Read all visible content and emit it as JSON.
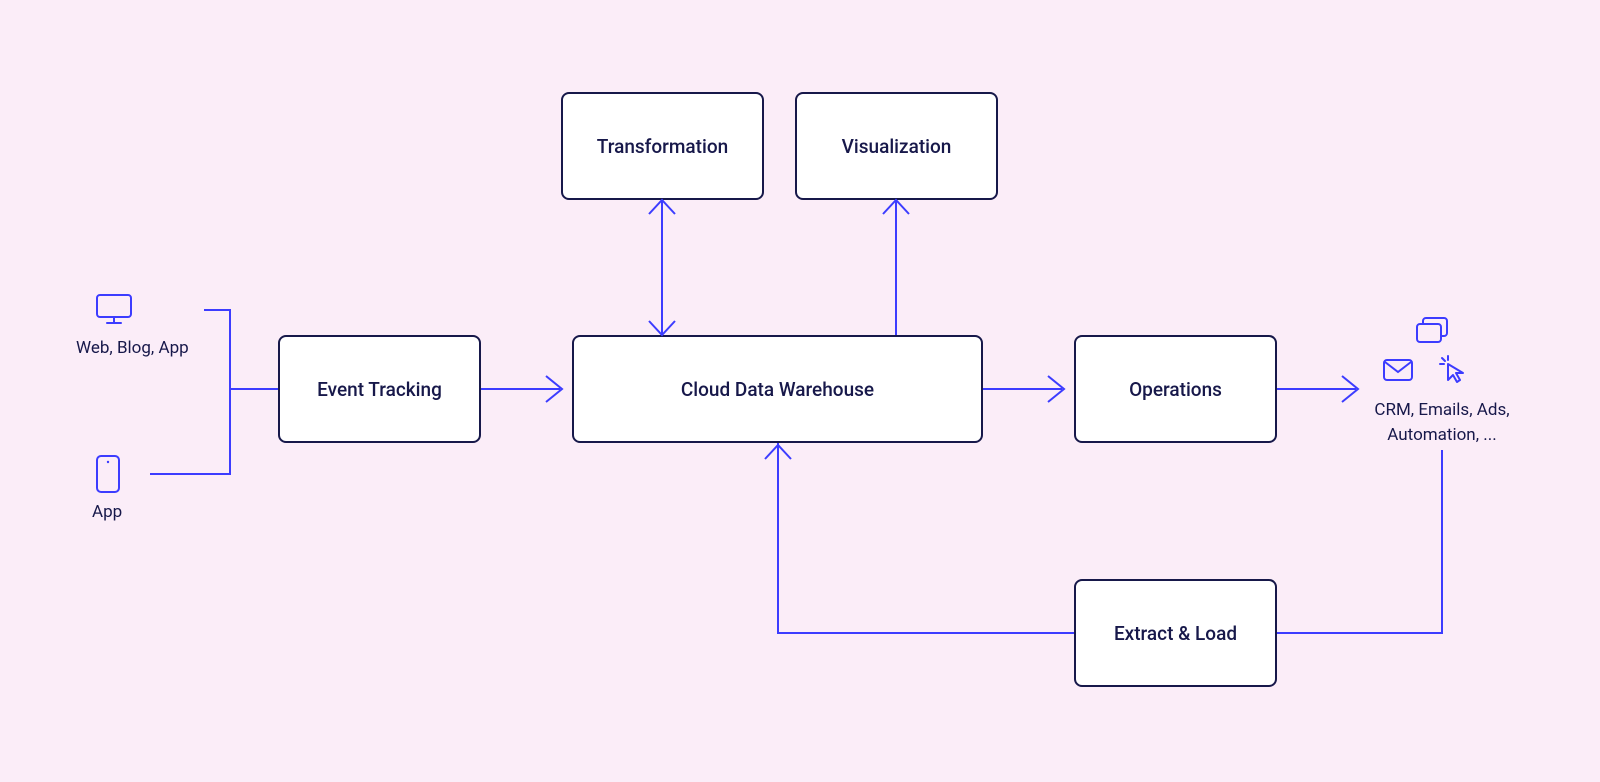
{
  "sources": {
    "web_label": "Web, Blog, App",
    "app_label": "App"
  },
  "nodes": {
    "event_tracking": "Event Tracking",
    "transformation": "Transformation",
    "visualization": "Visualization",
    "warehouse": "Cloud Data Warehouse",
    "operations": "Operations",
    "extract_load": "Extract & Load"
  },
  "destinations": {
    "label_line1": "CRM, Emails, Ads,",
    "label_line2": "Automation, ..."
  },
  "colors": {
    "background": "#fbedf8",
    "box_border": "#17184a",
    "box_fill": "#ffffff",
    "connector": "#3c3cff",
    "text": "#17184a"
  },
  "diagram_structure": {
    "description": "Data pipeline architecture diagram",
    "flows": [
      {
        "from": "Web, Blog, App",
        "to": "Event Tracking",
        "direction": "right"
      },
      {
        "from": "App",
        "to": "Event Tracking",
        "direction": "right"
      },
      {
        "from": "Event Tracking",
        "to": "Cloud Data Warehouse",
        "direction": "right"
      },
      {
        "from": "Cloud Data Warehouse",
        "to": "Transformation",
        "direction": "bidirectional"
      },
      {
        "from": "Cloud Data Warehouse",
        "to": "Visualization",
        "direction": "up"
      },
      {
        "from": "Cloud Data Warehouse",
        "to": "Operations",
        "direction": "right"
      },
      {
        "from": "Operations",
        "to": "CRM, Emails, Ads, Automation, ...",
        "direction": "right"
      },
      {
        "from": "CRM, Emails, Ads, Automation, ...",
        "to": "Extract & Load",
        "direction": "down"
      },
      {
        "from": "Extract & Load",
        "to": "Cloud Data Warehouse",
        "direction": "left-up"
      }
    ]
  }
}
